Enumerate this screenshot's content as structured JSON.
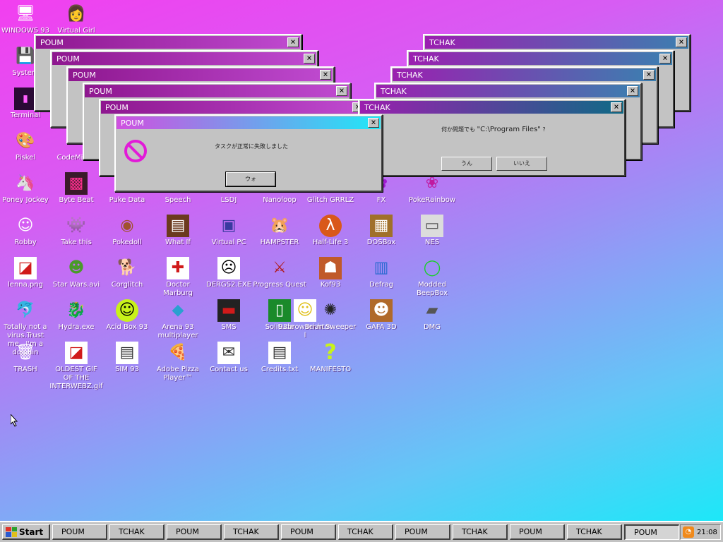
{
  "desktop_icons": [
    {
      "label": "WINDOWS 93",
      "glyph": "🖥",
      "icon": "computer-icon"
    },
    {
      "label": "Virtual Girl",
      "glyph": "👩",
      "icon": "virtual-girl-icon"
    },
    {
      "label": "System",
      "glyph": "💾",
      "icon": "system-icon"
    },
    {
      "label": "Terminal",
      "glyph": "▮",
      "icon": "terminal-icon"
    },
    {
      "label": "Piskel",
      "glyph": "🎨",
      "icon": "palette-icon"
    },
    {
      "label": "CodeMirror",
      "glyph": "✎",
      "icon": "code-icon"
    },
    {
      "label": "Poney Jockey",
      "glyph": "🦄",
      "icon": "pony-icon"
    },
    {
      "label": "Byte Beat",
      "glyph": "▩",
      "icon": "bytebeat-icon"
    },
    {
      "label": "Puke Data",
      "glyph": "≋",
      "icon": "puke-data-icon"
    },
    {
      "label": "Speech",
      "glyph": "☁",
      "icon": "speech-icon"
    },
    {
      "label": "LSDJ",
      "glyph": "♫",
      "icon": "lsdj-icon"
    },
    {
      "label": "Nanoloop",
      "glyph": "◎",
      "icon": "nanoloop-icon"
    },
    {
      "label": "Glitch GRRLZ",
      "glyph": "✦",
      "icon": "glitch-icon"
    },
    {
      "label": "FX",
      "glyph": "✿",
      "icon": "fx-icon"
    },
    {
      "label": "PokeRainbow",
      "glyph": "❀",
      "icon": "pokerainbow-icon"
    },
    {
      "label": "Robby",
      "glyph": "☺",
      "icon": "robot-icon"
    },
    {
      "label": "Take this",
      "glyph": "👾",
      "icon": "take-this-icon"
    },
    {
      "label": "Pokedoll",
      "glyph": "◉",
      "icon": "pokedoll-icon"
    },
    {
      "label": "What If",
      "glyph": "▤",
      "icon": "what-if-icon"
    },
    {
      "label": "Virtual PC",
      "glyph": "▣",
      "icon": "virtual-pc-icon"
    },
    {
      "label": "HAMPSTER",
      "glyph": "🐹",
      "icon": "hamster-icon"
    },
    {
      "label": "Half-Life 3",
      "glyph": "λ",
      "icon": "half-life-icon"
    },
    {
      "label": "DOSBox",
      "glyph": "▦",
      "icon": "dosbox-icon"
    },
    {
      "label": "NES",
      "glyph": "▭",
      "icon": "nes-icon"
    },
    {
      "label": "lenna.png",
      "glyph": "◪",
      "icon": "image-file-icon"
    },
    {
      "label": "Star Wars.avi",
      "glyph": "☻",
      "icon": "yoda-icon"
    },
    {
      "label": "Corglitch",
      "glyph": "🐕",
      "icon": "corgi-icon"
    },
    {
      "label": "Doctor Marburg",
      "glyph": "✚",
      "icon": "doctor-icon"
    },
    {
      "label": "DERGS2.EXE",
      "glyph": "☹",
      "icon": "exe-icon"
    },
    {
      "label": "Progress Quest",
      "glyph": "⚔",
      "icon": "swords-icon"
    },
    {
      "label": "Kof93",
      "glyph": "☗",
      "icon": "fighter-icon"
    },
    {
      "label": "Defrag",
      "glyph": "▥",
      "icon": "defrag-icon"
    },
    {
      "label": "Modded BeepBox",
      "glyph": "◯",
      "icon": "beepbox-icon"
    },
    {
      "label": "Totally not a virus.Trust me...I'm a dolphin",
      "glyph": "🐬",
      "icon": "dolphin-icon"
    },
    {
      "label": "Hydra.exe",
      "glyph": "🐉",
      "icon": "hydra-icon"
    },
    {
      "label": "Acid Box 93",
      "glyph": "☺",
      "icon": "acid-smiley-icon"
    },
    {
      "label": "Arena 93 multiplayer",
      "glyph": "◆",
      "icon": "cube-icon"
    },
    {
      "label": "SMS",
      "glyph": "▬",
      "icon": "sms-console-icon"
    },
    {
      "label": "Solitude",
      "glyph": "▯",
      "icon": "solitude-icon"
    },
    {
      "label": "93browser.html",
      "glyph": "☺",
      "icon": "browser-icon"
    },
    {
      "label": "Brian Sweeper",
      "glyph": "✺",
      "icon": "mine-icon"
    },
    {
      "label": "GAFA 3D",
      "glyph": "☻",
      "icon": "doom-face-icon"
    },
    {
      "label": "DMG",
      "glyph": "▰",
      "icon": "dmg-icon"
    },
    {
      "label": "TRASH",
      "glyph": "🗑",
      "icon": "trash-icon"
    },
    {
      "label": "OLDEST GIF OF THE INTERWEBZ.gif",
      "glyph": "◪",
      "icon": "gif-file-icon"
    },
    {
      "label": "SIM 93",
      "glyph": "▤",
      "icon": "sim-icon"
    },
    {
      "label": "Adobe Pizza Player™",
      "glyph": "🍕",
      "icon": "pizza-icon"
    },
    {
      "label": "Contact us",
      "glyph": "✉",
      "icon": "contact-icon"
    },
    {
      "label": "Credits.txt",
      "glyph": "▤",
      "icon": "text-file-icon"
    },
    {
      "label": "MANIFESTO",
      "glyph": "?",
      "icon": "question-icon"
    }
  ],
  "poum_windows": {
    "title": "POUM",
    "message": "タスクが正常に失敗しました",
    "ok_label": "ウォ"
  },
  "tchak_windows": {
    "title": "TCHAK",
    "message_prefix": "何か問題でも",
    "message_path": "\"C:\\Program Files\"",
    "message_suffix": "?",
    "yes_label": "うん",
    "no_label": "いいえ"
  },
  "taskbar": {
    "start_label": "Start",
    "tasks": [
      "POUM",
      "TCHAK",
      "POUM",
      "TCHAK",
      "POUM",
      "TCHAK",
      "POUM",
      "TCHAK",
      "POUM",
      "TCHAK",
      "POUM"
    ],
    "clock": "21:08"
  },
  "colors": {
    "accent_pink": "#e21ad8",
    "gradient_top": "#f23ff0",
    "gradient_bottom": "#13ecf8"
  }
}
